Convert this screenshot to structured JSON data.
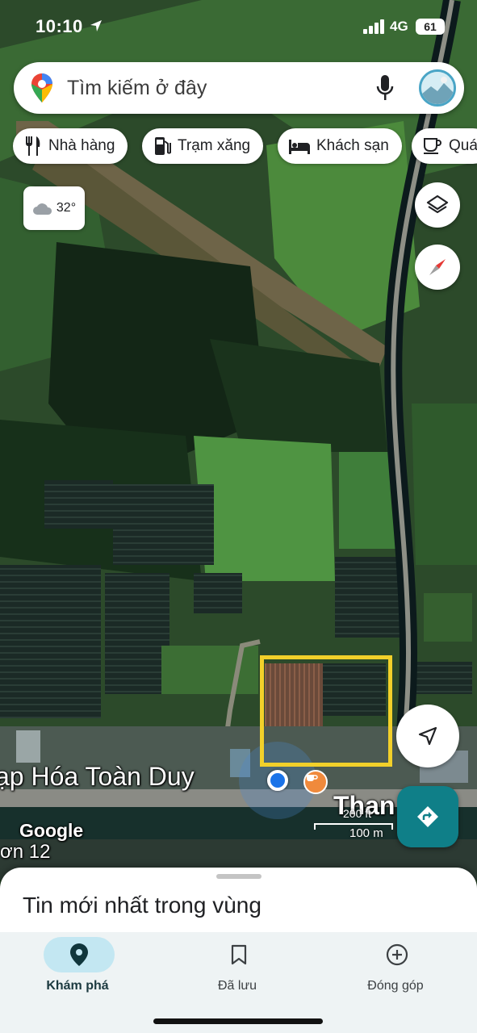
{
  "status_bar": {
    "time": "10:10",
    "network": "4G",
    "battery": "61"
  },
  "search": {
    "placeholder": "Tìm kiếm ở đây"
  },
  "chips": [
    {
      "label": "Nhà hàng",
      "icon": "restaurant-icon"
    },
    {
      "label": "Trạm xăng",
      "icon": "gas-station-icon"
    },
    {
      "label": "Khách sạn",
      "icon": "hotel-icon"
    },
    {
      "label": "Quá",
      "icon": "cafe-icon"
    }
  ],
  "weather": {
    "temp": "32°",
    "icon": "cloud-icon"
  },
  "map": {
    "poi_label": "ạp Hóa Toàn Duy",
    "google_logo": "Google",
    "street_label": "ơn 12",
    "place_label": "Than",
    "scale_top": "200 ft",
    "scale_bottom": "100 m",
    "highlight_color": "#f2d02a"
  },
  "sheet": {
    "title": "Tin mới nhất trong vùng"
  },
  "tabs": [
    {
      "label": "Khám phá",
      "icon": "location-pin-icon",
      "active": true
    },
    {
      "label": "Đã lưu",
      "icon": "bookmark-icon",
      "active": false
    },
    {
      "label": "Đóng góp",
      "icon": "add-circle-icon",
      "active": false
    }
  ],
  "colors": {
    "accent": "#0f7f88",
    "active_tab_bg": "#c3e7f2"
  }
}
